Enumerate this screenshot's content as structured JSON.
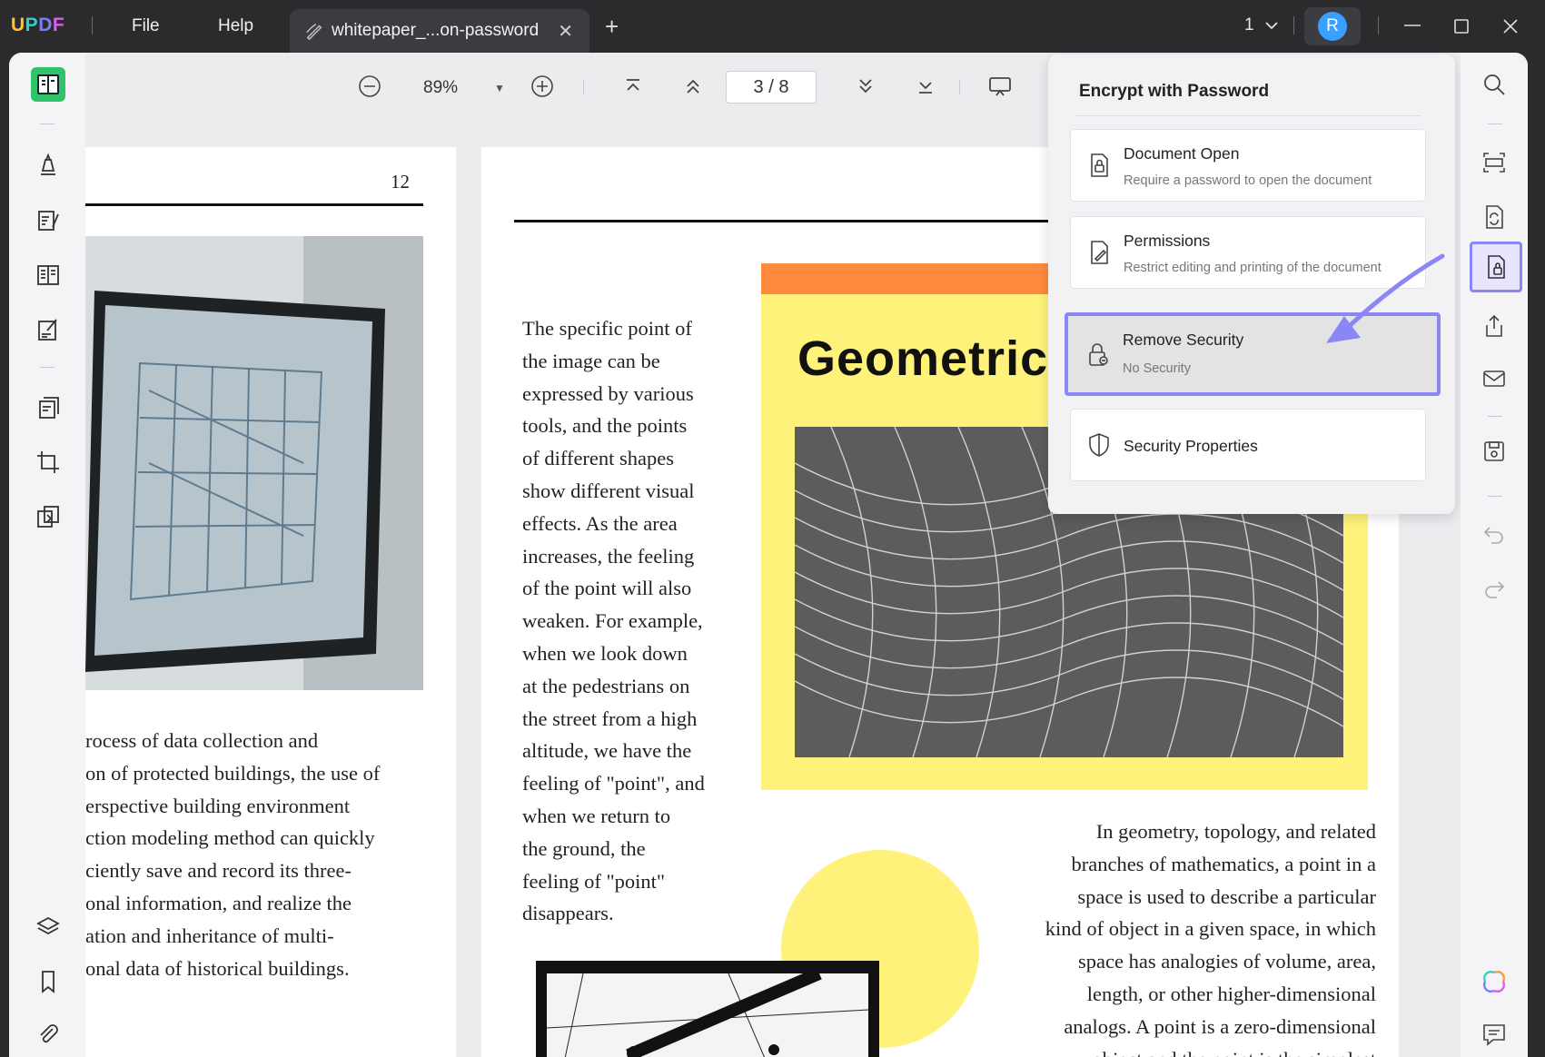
{
  "app": {
    "logo": [
      "U",
      "P",
      "D",
      "F"
    ]
  },
  "menu": {
    "file": "File",
    "help": "Help"
  },
  "tab": {
    "title": "whitepaper_...on-password",
    "close": "✕",
    "new": "+"
  },
  "titlebar": {
    "page_indicator": "1",
    "avatar_letter": "R"
  },
  "toolbar": {
    "zoom": "89%",
    "page_current": "3",
    "page_sep": "/",
    "page_total": "8",
    "page_display": "3 / 8"
  },
  "encrypt_panel": {
    "title": "Encrypt with Password",
    "options": [
      {
        "title": "Document Open",
        "desc": "Require a password to open the document"
      },
      {
        "title": "Permissions",
        "desc": "Restrict editing and printing of the document"
      },
      {
        "title": "Remove Security",
        "desc": "No Security"
      },
      {
        "title": "Security Properties",
        "desc": ""
      }
    ]
  },
  "page_left": {
    "number": "12",
    "lines": [
      "rocess of data collection and",
      "on of protected buildings, the use of",
      "erspective building environment",
      "ction modeling method can quickly",
      "ciently save and record its three-",
      "onal information, and realize the",
      "ation and inheritance of multi-",
      "onal data of historical buildings."
    ]
  },
  "page_right": {
    "card_title": "Geometric",
    "column_lines": [
      "The specific point of",
      "the image can be",
      "expressed by various",
      "tools, and the points",
      "of different shapes",
      "show different visual",
      "effects. As the area",
      "increases, the feeling",
      "of the point will also",
      "weaken. For example,",
      "when we look down",
      "at the pedestrians on",
      "the street from a high",
      "altitude, we have the",
      "feeling of \"point\", and",
      "when we return to",
      "the ground, the",
      "feeling of \"point\"",
      "disappears."
    ],
    "para_lines": [
      "In geometry, topology, and related",
      "branches of mathematics, a point in a",
      "space is used to describe a particular",
      "kind of object in a given space, in which",
      "space has analogies of volume, area,",
      "length, or other higher-dimensional",
      "analogs. A point is a zero-dimensional",
      "object and the point is the simplest"
    ]
  },
  "colors": {
    "accent": "#8b86f5",
    "active_green": "#2fc36a",
    "card_yellow": "#fff27a",
    "card_orange": "#ff8a3d"
  }
}
